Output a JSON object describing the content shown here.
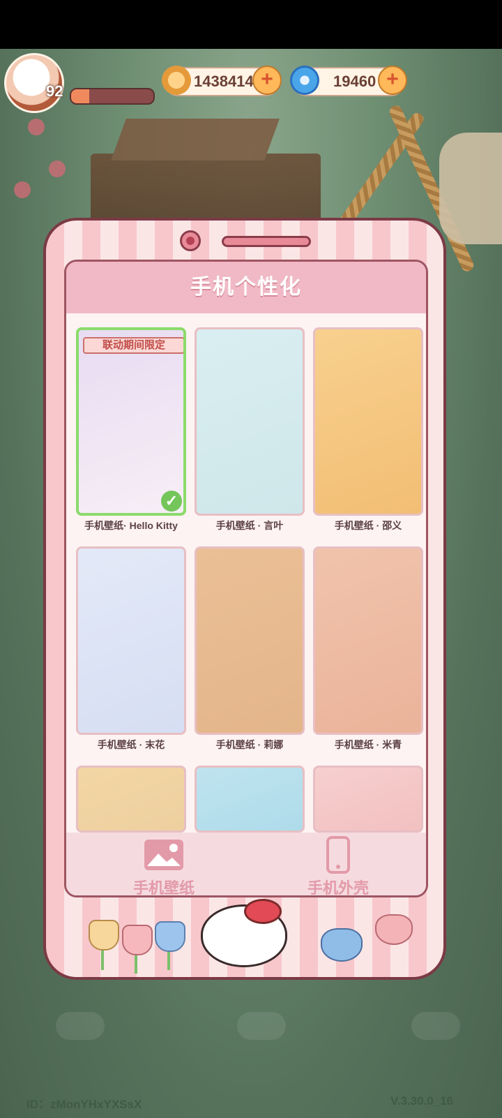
{
  "hud": {
    "level": "92",
    "xp_fraction": 0.22,
    "coins": "1438414",
    "gems": "19460"
  },
  "panel": {
    "title": "手机个性化",
    "limited_tag": "联动期间限定",
    "wallpapers": [
      {
        "label": "手机壁纸· Hello Kitty",
        "selected": true,
        "colors": [
          "#e7dcf2",
          "#f7eef6"
        ]
      },
      {
        "label": "手机壁纸 · 言叶",
        "selected": false,
        "colors": [
          "#d9eef0",
          "#cfe7ea"
        ]
      },
      {
        "label": "手机壁纸 · 邵义",
        "selected": false,
        "colors": [
          "#f8d08e",
          "#f2be74"
        ]
      },
      {
        "label": "手机壁纸 · 末花",
        "selected": false,
        "colors": [
          "#e3e9f7",
          "#d6def3"
        ]
      },
      {
        "label": "手机壁纸 · 莉娜",
        "selected": false,
        "colors": [
          "#ebbf96",
          "#e4b58a"
        ]
      },
      {
        "label": "手机壁纸 · 米青",
        "selected": false,
        "colors": [
          "#f1c3ab",
          "#eab39a"
        ]
      },
      {
        "label": "",
        "selected": false,
        "colors": [
          "#f3d6a4",
          "#eed0a0"
        ]
      },
      {
        "label": "",
        "selected": false,
        "colors": [
          "#bfe3ef",
          "#aedbea"
        ]
      },
      {
        "label": "",
        "selected": false,
        "colors": [
          "#f7cfcf",
          "#f2c0c0"
        ]
      }
    ],
    "tabs": [
      {
        "label": "手机壁纸",
        "icon": "picture-icon"
      },
      {
        "label": "手机外壳",
        "icon": "phone-icon"
      }
    ]
  },
  "footer": {
    "id_text": "ID：zMonYHxYXSsX",
    "version": "V.3.30.0_16"
  }
}
